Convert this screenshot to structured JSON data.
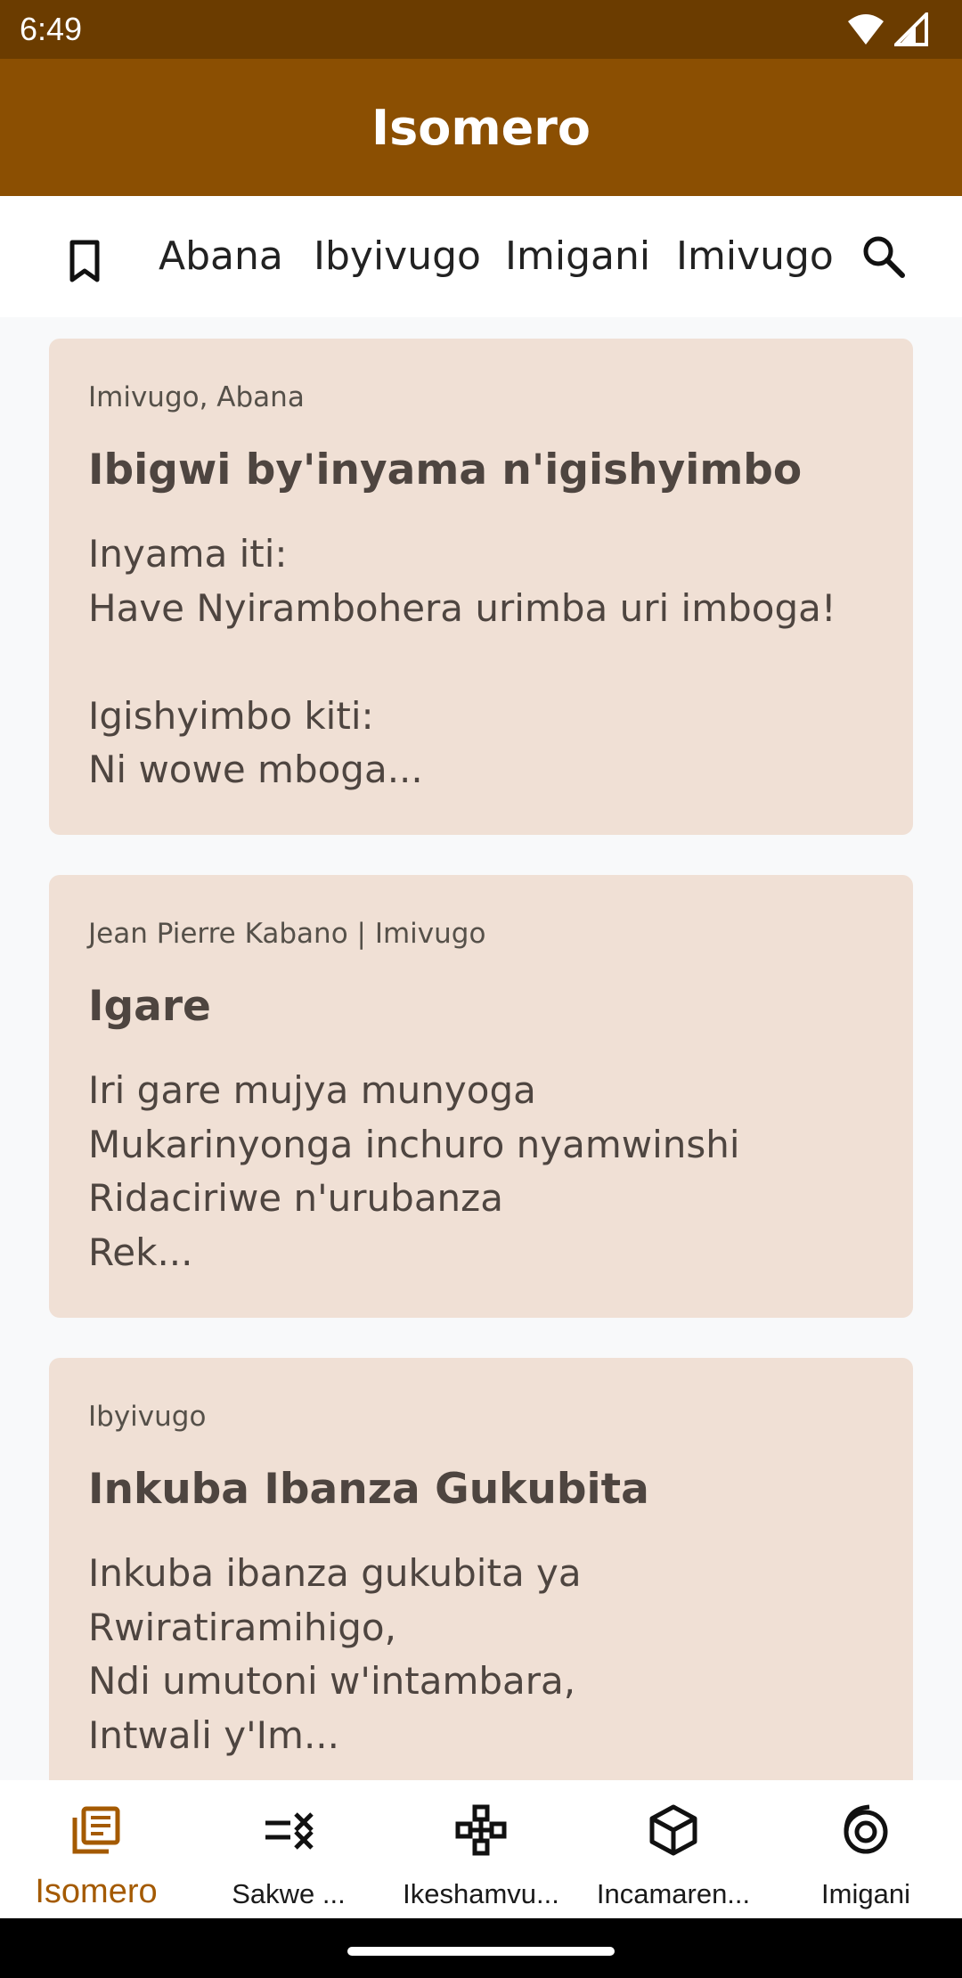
{
  "status_bar": {
    "time": "6:49"
  },
  "app_bar": {
    "title": "Isomero"
  },
  "tabs": {
    "items": [
      {
        "label": "Abana"
      },
      {
        "label": "Ibyivugo"
      },
      {
        "label": "Imigani"
      },
      {
        "label": "Imivugo"
      }
    ],
    "bookmark_icon": "bookmark-icon",
    "search_icon": "search-icon"
  },
  "cards": [
    {
      "meta": "Imivugo, Abana",
      "title": "Ibigwi by'inyama n'igishyimbo",
      "body": "Inyama iti:\nHave Nyirambohera urimba uri imboga!\n\nIgishyimbo kiti:\nNi wowe mboga..."
    },
    {
      "meta": "Jean Pierre Kabano | Imivugo",
      "title": "Igare",
      "body": "Iri gare mujya munyoga\nMukarinyonga inchuro nyamwinshi\nRidaciriwe n'urubanza\nRek..."
    },
    {
      "meta": "Ibyivugo",
      "title": "Inkuba Ibanza Gukubita",
      "body": "Inkuba ibanza gukubita ya\nRwiratiramihigo,\nNdi umutoni w'intambara,\nIntwali y'Im..."
    }
  ],
  "bottom_nav": {
    "items": [
      {
        "label": "Isomero",
        "icon": "library-icon",
        "active": true
      },
      {
        "label": "Sakwe ...",
        "icon": "quiz-icon",
        "active": false
      },
      {
        "label": "Ikeshamvu...",
        "icon": "game-icon",
        "active": false
      },
      {
        "label": "Incamaren...",
        "icon": "cube-icon",
        "active": false
      },
      {
        "label": "Imigani",
        "icon": "spiral-icon",
        "active": false
      }
    ]
  },
  "colors": {
    "status_bar": "#6b3c00",
    "app_bar": "#8b4f02",
    "card_bg": "#f0e0d5",
    "active_nav": "#a45a00"
  }
}
